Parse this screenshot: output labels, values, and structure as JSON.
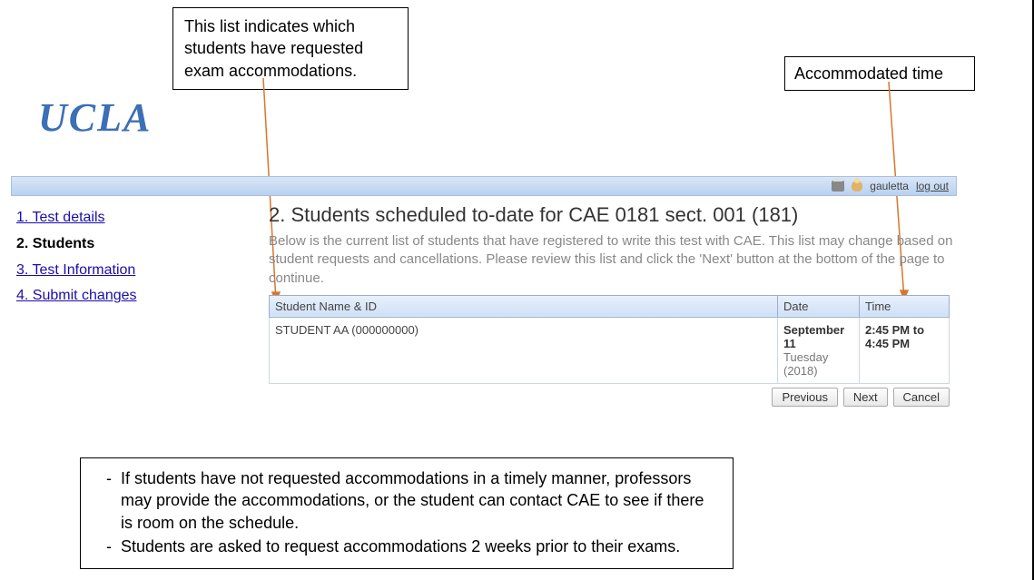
{
  "callouts": {
    "list_note": "This list indicates which students have requested exam accommodations.",
    "time_note": "Accommodated time"
  },
  "logo_text": "UCLA",
  "topbar": {
    "username": "gauletta",
    "logout": "log out"
  },
  "sidebar": {
    "items": [
      {
        "label": "1. Test details"
      },
      {
        "label": "2. Students"
      },
      {
        "label": "3. Test Information"
      },
      {
        "label": "4. Submit changes"
      }
    ]
  },
  "main": {
    "title": "2. Students scheduled to-date for CAE 0181 sect. 001 (181)",
    "description": "Below is the current list of students that have registered to write this test with CAE. This list may change based on student requests and cancellations. Please review this list and click the 'Next' button at the bottom of the page to continue.",
    "columns": {
      "name": "Student Name & ID",
      "date": "Date",
      "time": "Time"
    },
    "rows": [
      {
        "name": "STUDENT AA (000000000)",
        "date_main": "September 11",
        "date_sub": "Tuesday (2018)",
        "time": "2:45 PM to 4:45 PM"
      }
    ],
    "buttons": {
      "prev": "Previous",
      "next": "Next",
      "cancel": "Cancel"
    }
  },
  "notes": {
    "item1": "If students have not requested accommodations in a timely manner, professors may provide the accommodations, or the student can contact CAE to see if there is room on the schedule.",
    "item2": "Students are asked to request accommodations 2 weeks prior to their exams."
  }
}
